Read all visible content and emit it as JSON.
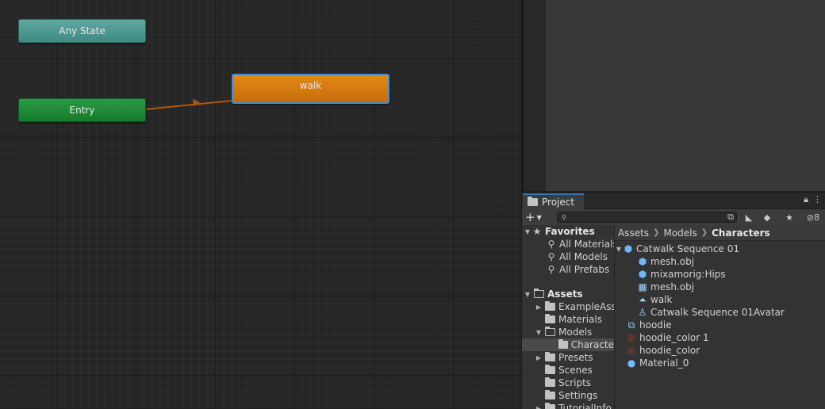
{
  "graph": {
    "nodes": {
      "any_state": "Any State",
      "entry": "Entry",
      "walk": "walk"
    },
    "transition_color": "#b4560e"
  },
  "project": {
    "tab_label": "Project",
    "tab_icons": [
      "lock-icon",
      "kebab-menu-icon"
    ],
    "toolbar": {
      "search_value": "",
      "hidden_count": "8"
    },
    "breadcrumb": [
      "Assets",
      "Models",
      "Characters"
    ],
    "tree": {
      "favorites": {
        "label": "Favorites",
        "items": [
          "All Materials",
          "All Models",
          "All Prefabs"
        ]
      },
      "assets": {
        "label": "Assets",
        "items": [
          "ExampleAss",
          "Materials",
          "Models",
          "Characte",
          "Presets",
          "Scenes",
          "Scripts",
          "Settings",
          "TutorialInfo"
        ]
      }
    },
    "files": [
      {
        "label": "Catwalk Sequence 01",
        "icon": "model-prefab-icon"
      },
      {
        "label": "mesh.obj",
        "icon": "mesh-cube-icon"
      },
      {
        "label": "mixamorig:Hips",
        "icon": "mesh-cube-icon"
      },
      {
        "label": "mesh.obj",
        "icon": "grid-mesh-icon"
      },
      {
        "label": "walk",
        "icon": "animation-clip-icon"
      },
      {
        "label": "Catwalk Sequence 01Avatar",
        "icon": "avatar-icon"
      },
      {
        "label": "hoodie",
        "icon": "texture-icon"
      },
      {
        "label": "hoodie_color 1",
        "icon": "texture-dark-icon"
      },
      {
        "label": "hoodie_color",
        "icon": "texture-dark-icon"
      },
      {
        "label": "Material_0",
        "icon": "material-sphere-icon"
      }
    ]
  },
  "colors": {
    "any_state": "#4f9b93",
    "entry": "#1e8a37",
    "walk": "#d57a10",
    "selection_outline": "#3f8fd6"
  }
}
